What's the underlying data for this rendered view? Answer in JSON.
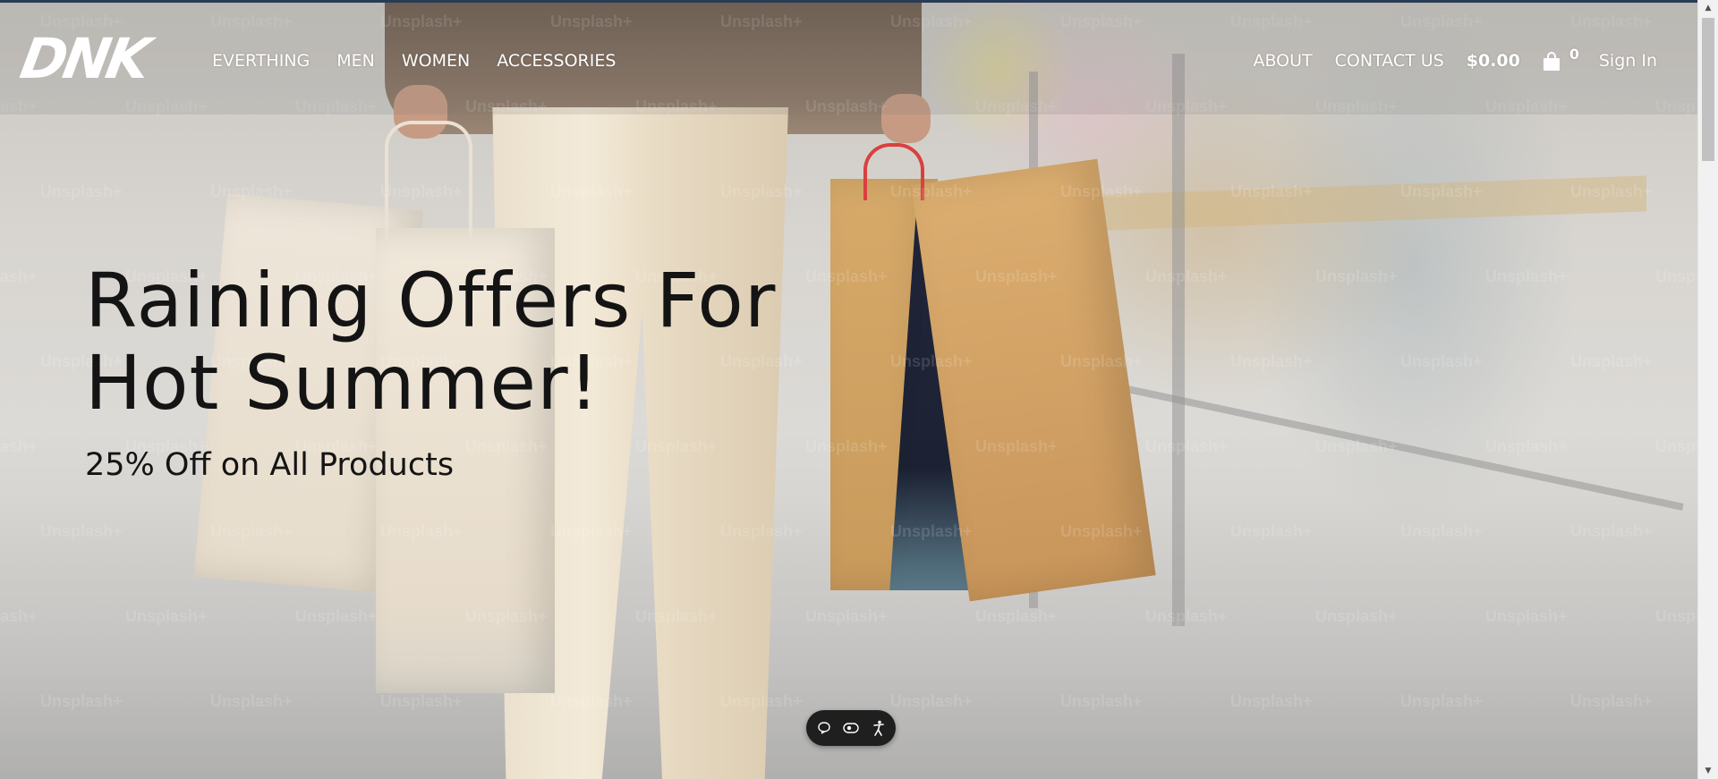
{
  "brand": {
    "logo_text": "DNK"
  },
  "nav": {
    "items": [
      {
        "label": "EVERTHING"
      },
      {
        "label": "MEN"
      },
      {
        "label": "WOMEN"
      },
      {
        "label": "ACCESSORIES"
      }
    ]
  },
  "right_nav": {
    "about": "ABOUT",
    "contact": "CONTACT US",
    "cart_total": "$0.00",
    "cart_count": "0",
    "sign_in": "Sign In"
  },
  "hero": {
    "title": "Raining Offers For Hot Summer!",
    "subtitle": "25% Off on All Products",
    "watermark": "Unsplash+"
  },
  "widget": {
    "icons": [
      "chat-bubble-icon",
      "eye-toggle-icon",
      "accessibility-icon"
    ]
  },
  "colors": {
    "header_text": "#ffffff",
    "hero_text": "#141414",
    "widget_bg": "#1f1f1f",
    "top_stripe": "#2a3b55"
  }
}
